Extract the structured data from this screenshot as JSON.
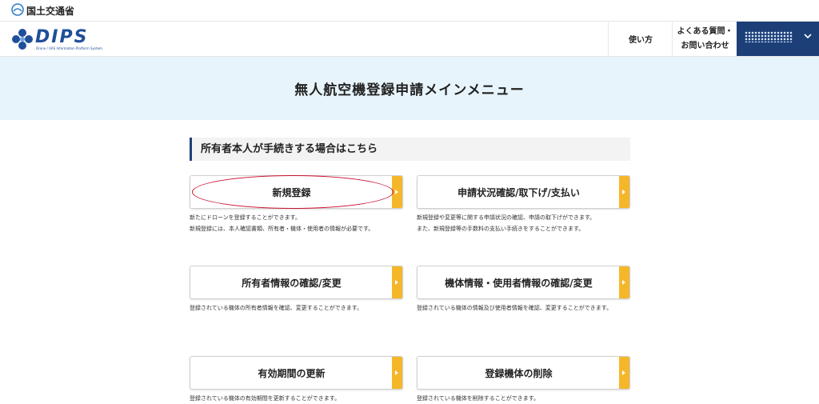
{
  "ministry": {
    "name": "国土交通省",
    "icon": "mlit-logo-icon"
  },
  "header": {
    "logo_text": "DIPS",
    "logo_subtext": "Drone / UAS Information Platform System",
    "nav_howto": "使い方",
    "nav_faq_line1": "よくある質問・",
    "nav_faq_line2": "お問い合わせ",
    "user_icon": "chevron-down-icon"
  },
  "hero": {
    "title": "無人航空機登録申請メインメニュー"
  },
  "section": {
    "title": "所有者本人が手続きする場合はこちら"
  },
  "cards": [
    {
      "label": "新規登録",
      "desc1": "新たにドローンを登録することができます。",
      "desc2": "新規登録には、本人確認書類、所有者・機体・使用者の情報が必要です。"
    },
    {
      "label": "申請状況確認/取下げ/支払い",
      "desc1": "新規登録や変更等に関する申請状況の確認、申請の取下げができます。",
      "desc2": "また、新規登録等の手数料の支払い手続きをすることができます。"
    },
    {
      "label": "所有者情報の確認/変更",
      "desc1": "登録されている機体の所有者情報を確認、変更することができます。"
    },
    {
      "label": "機体情報・使用者情報の確認/変更",
      "desc1": "登録されている機体の情報及び使用者情報を確認、変更することができます。"
    },
    {
      "label": "有効期間の更新",
      "desc1": "登録されている機体の有効期間を更新することができます。"
    },
    {
      "label": "登録機体の削除",
      "desc1": "登録されている機体を削除することができます。"
    }
  ],
  "colors": {
    "brand": "#1c3f77",
    "accent": "#f5b72a",
    "hero_bg": "#e7f4fb",
    "highlight": "#c8102e"
  }
}
